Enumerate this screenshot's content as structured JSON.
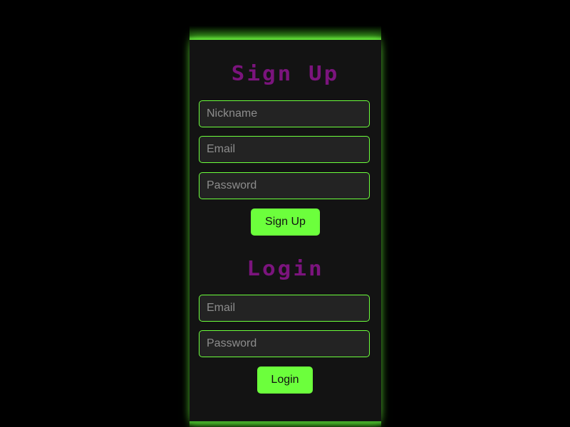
{
  "colors": {
    "background": "#000000",
    "panel": "#131313",
    "accent_green": "#6cff3c",
    "heading_purple": "#7b147d",
    "input_bg": "#232323",
    "placeholder": "#8d8d8d"
  },
  "signup": {
    "title": "Sign Up",
    "nickname_placeholder": "Nickname",
    "email_placeholder": "Email",
    "password_placeholder": "Password",
    "button_label": "Sign Up"
  },
  "login": {
    "title": "Login",
    "email_placeholder": "Email",
    "password_placeholder": "Password",
    "button_label": "Login"
  }
}
